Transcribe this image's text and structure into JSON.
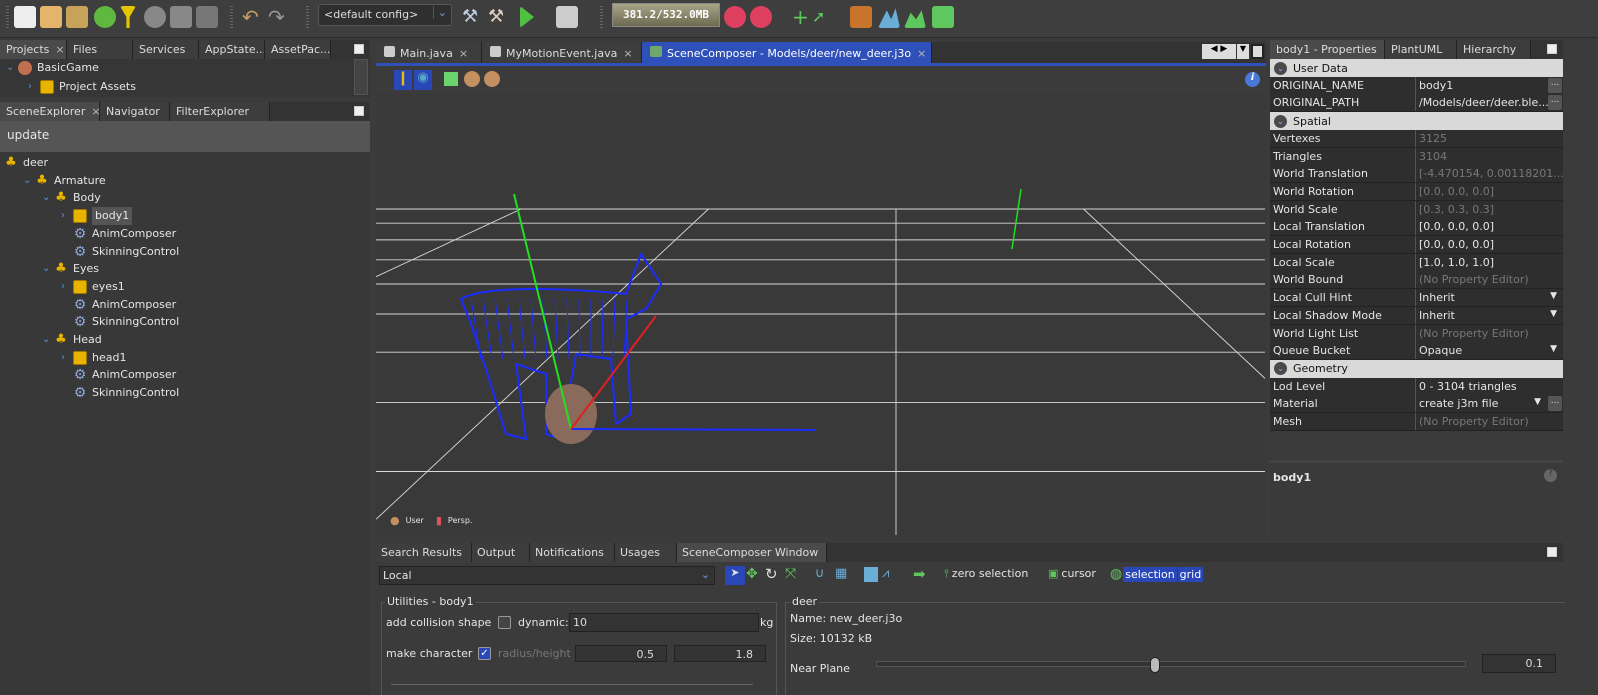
{
  "toolbar": {
    "config": "<default config>",
    "memory": "381.2/532.0MB",
    "icons": [
      "new-file-icon",
      "new-project-icon",
      "open-project-icon",
      "download-icon",
      "filter-icon",
      "blender-icon",
      "save-icon",
      "save-all-icon",
      "undo-icon",
      "redo-icon",
      "build-icon",
      "clean-build-icon",
      "run-icon",
      "debug-icon",
      "profile-icon",
      "gc-icon",
      "add-icon",
      "arrow-icon",
      "image-icon",
      "terrain-icon",
      "mountain-icon",
      "vehicle-icon"
    ]
  },
  "projects_panel": {
    "tabs": [
      "Projects",
      "Files",
      "Services",
      "AppState...",
      "AssetPac..."
    ],
    "tree": [
      "BasicGame",
      "Project Assets"
    ]
  },
  "scene_explorer": {
    "tabs": [
      "SceneExplorer",
      "Navigator",
      "FilterExplorer"
    ],
    "update_label": "update",
    "tree": [
      {
        "label": "deer",
        "type": "node",
        "level": 0
      },
      {
        "label": "Armature",
        "type": "node",
        "level": 1
      },
      {
        "label": "Body",
        "type": "node",
        "level": 2
      },
      {
        "label": "body1",
        "type": "geometry",
        "level": 3,
        "selected": true
      },
      {
        "label": "AnimComposer",
        "type": "control",
        "level": 3
      },
      {
        "label": "SkinningControl",
        "type": "control",
        "level": 3
      },
      {
        "label": "Eyes",
        "type": "node",
        "level": 2
      },
      {
        "label": "eyes1",
        "type": "geometry",
        "level": 3
      },
      {
        "label": "AnimComposer",
        "type": "control",
        "level": 3
      },
      {
        "label": "SkinningControl",
        "type": "control",
        "level": 3
      },
      {
        "label": "Head",
        "type": "node",
        "level": 2
      },
      {
        "label": "head1",
        "type": "geometry",
        "level": 3
      },
      {
        "label": "AnimComposer",
        "type": "control",
        "level": 3
      },
      {
        "label": "SkinningControl",
        "type": "control",
        "level": 3
      }
    ]
  },
  "editor": {
    "tabs": [
      "Main.java",
      "MyMotionEvent.java",
      "SceneComposer - Models/deer/new_deer.j3o"
    ],
    "active_tab": 2,
    "viewport_footer": {
      "camera": "User",
      "projection": "Persp."
    }
  },
  "properties": {
    "tabs": [
      "body1 - Properties",
      "PlantUML",
      "Hierarchy"
    ],
    "sections": [
      {
        "title": "User Data",
        "rows": [
          {
            "k": "ORIGINAL_NAME",
            "v": "body1",
            "edit": "dots"
          },
          {
            "k": "ORIGINAL_PATH",
            "v": "/Models/deer/deer.ble...",
            "edit": "dots"
          }
        ]
      },
      {
        "title": "Spatial",
        "rows": [
          {
            "k": "Vertexes",
            "v": "3125",
            "ro": true
          },
          {
            "k": "Triangles",
            "v": "3104",
            "ro": true
          },
          {
            "k": "World Translation",
            "v": "[-4.470154, 0.00118201...",
            "ro": true
          },
          {
            "k": "World Rotation",
            "v": "[0.0, 0.0, 0.0]",
            "ro": true
          },
          {
            "k": "World Scale",
            "v": "[0.3, 0.3, 0.3]",
            "ro": true
          },
          {
            "k": "Local Translation",
            "v": "[0.0, 0.0, 0.0]"
          },
          {
            "k": "Local Rotation",
            "v": "[0.0, 0.0, 0.0]"
          },
          {
            "k": "Local Scale",
            "v": "[1.0, 1.0, 1.0]"
          },
          {
            "k": "World Bound",
            "v": "(No Property Editor)",
            "ro": true
          },
          {
            "k": "Local Cull Hint",
            "v": "Inherit",
            "edit": "dropdown"
          },
          {
            "k": "Local Shadow Mode",
            "v": "Inherit",
            "edit": "dropdown"
          },
          {
            "k": "World Light List",
            "v": "(No Property Editor)",
            "ro": true
          },
          {
            "k": "Queue Bucket",
            "v": "Opaque",
            "edit": "dropdown"
          }
        ]
      },
      {
        "title": "Geometry",
        "rows": [
          {
            "k": "Lod Level",
            "v": "0 - 3104 triangles"
          },
          {
            "k": "Material",
            "v": "create j3m file",
            "edit": "dropdown-dots"
          },
          {
            "k": "Mesh",
            "v": "(No Property Editor)",
            "ro": true
          }
        ]
      }
    ],
    "description_title": "body1"
  },
  "bottom": {
    "tabs": [
      "Search Results",
      "Output",
      "Notifications",
      "Usages",
      "SceneComposer Window"
    ],
    "mode": "Local",
    "zero_selection": "zero selection",
    "cursor": "cursor",
    "selection": "selection",
    "grid": "grid",
    "utilities": {
      "title": "Utilities - body1",
      "add_collision": "add collision shape",
      "dynamic": "dynamic:",
      "mass": "10",
      "kg": "kg",
      "make_character": "make character",
      "radius_height": "radius/height",
      "radius": "0.5",
      "height": "1.8",
      "make_character_checked": true,
      "add_collision_checked": false
    },
    "info": {
      "title": "deer",
      "name": "Name: new_deer.j3o",
      "size": "Size: 10132 kB",
      "near_plane": "Near Plane",
      "near_value": "0.1"
    }
  }
}
